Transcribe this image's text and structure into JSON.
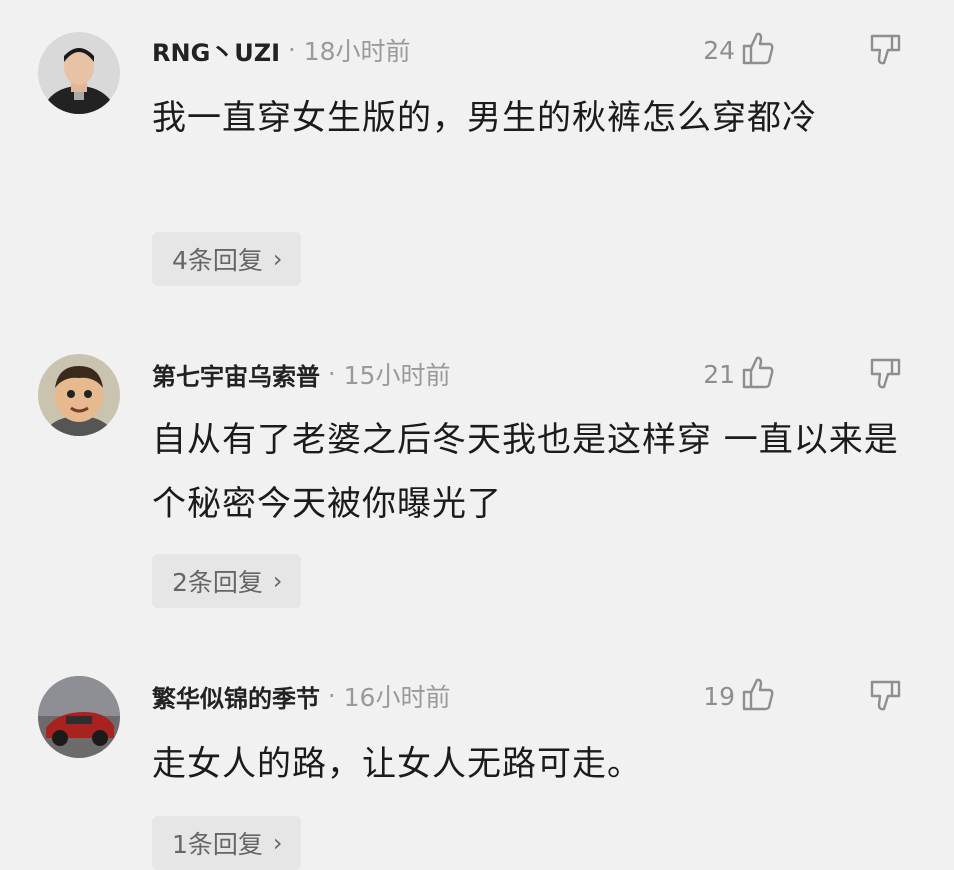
{
  "comments": [
    {
      "username": "RNG丶UZI",
      "separator": "·",
      "time": "18小时前",
      "likes": "24",
      "text": "我一直穿女生版的，男生的秋裤怎么穿都冷",
      "replies": "4条回复",
      "reply_chevron": "›"
    },
    {
      "username": "第七宇宙乌索普",
      "separator": "·",
      "time": "15小时前",
      "likes": "21",
      "text": "自从有了老婆之后冬天我也是这样穿  一直以来是个秘密今天被你曝光了",
      "replies": "2条回复",
      "reply_chevron": "›"
    },
    {
      "username": "繁华似锦的季节",
      "separator": "·",
      "time": "16小时前",
      "likes": "19",
      "text": "走女人的路，让女人无路可走。",
      "replies": "1条回复",
      "reply_chevron": "›"
    }
  ],
  "icons": {
    "like": "thumbs-up-icon",
    "dislike": "thumbs-down-icon"
  },
  "colors": {
    "background": "#f1f1f1",
    "reply_button_bg": "#e6e6e6",
    "muted_text": "#9a9a9a"
  }
}
